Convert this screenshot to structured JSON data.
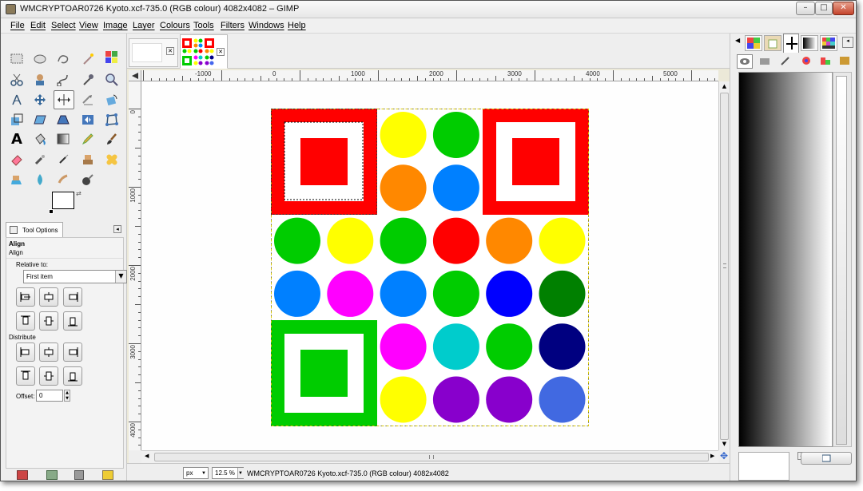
{
  "window": {
    "title": "WMCRYPTOAR0726 Kyoto.xcf-735.0 (RGB colour) 4082x4082 – GIMP",
    "minimize_glyph": "–",
    "maximize_glyph": "□",
    "close_glyph": "✕"
  },
  "menu": [
    "File",
    "Edit",
    "Select",
    "View",
    "Image",
    "Layer",
    "Colours",
    "Tools",
    "Filters",
    "Windows",
    "Help"
  ],
  "tool_options": {
    "tab_label": "Tool Options",
    "title": "Align",
    "subtitle": "Align",
    "relative_to_label": "Relative to:",
    "relative_to_value": "First item",
    "distribute_label": "Distribute",
    "offset_label": "Offset:",
    "offset_value": "0"
  },
  "rulers": {
    "top": [
      "-1000",
      "0",
      "1000",
      "2000",
      "3000",
      "4000",
      "5000"
    ],
    "left": [
      "0",
      "1000",
      "2000",
      "3000",
      "4000"
    ]
  },
  "statusbar": {
    "unit": "px",
    "zoom": "12.5 %",
    "message": "WMCRYPTOAR0726 Kyoto.xcf-735.0 (RGB colour) 4082x4082"
  },
  "image_tabs": {
    "close_glyph": "✕"
  },
  "artwork": {
    "squares": [
      {
        "name": "red-square-top-left",
        "color": "#ff0000"
      },
      {
        "name": "red-square-top-right",
        "color": "#ff0000"
      },
      {
        "name": "green-square-bottom-left",
        "color": "#00cc00"
      }
    ],
    "circles": [
      [
        "",
        "",
        "#ffff00",
        "#00cc00",
        "",
        ""
      ],
      [
        "",
        "",
        "#ff8800",
        "#0080ff",
        "",
        ""
      ],
      [
        "#00cc00",
        "#ffff00",
        "#00cc00",
        "#ff0000",
        "#ff8800",
        "#ffff00"
      ],
      [
        "#0080ff",
        "#ff00ff",
        "#0080ff",
        "#00cc00",
        "#0000ff",
        "#008000"
      ],
      [
        "",
        "",
        "#ff00ff",
        "#00cccc",
        "#00cc00",
        "#000080"
      ],
      [
        "",
        "",
        "#ffff00",
        "#8800cc",
        "#8800cc",
        "#4169e1"
      ]
    ]
  }
}
